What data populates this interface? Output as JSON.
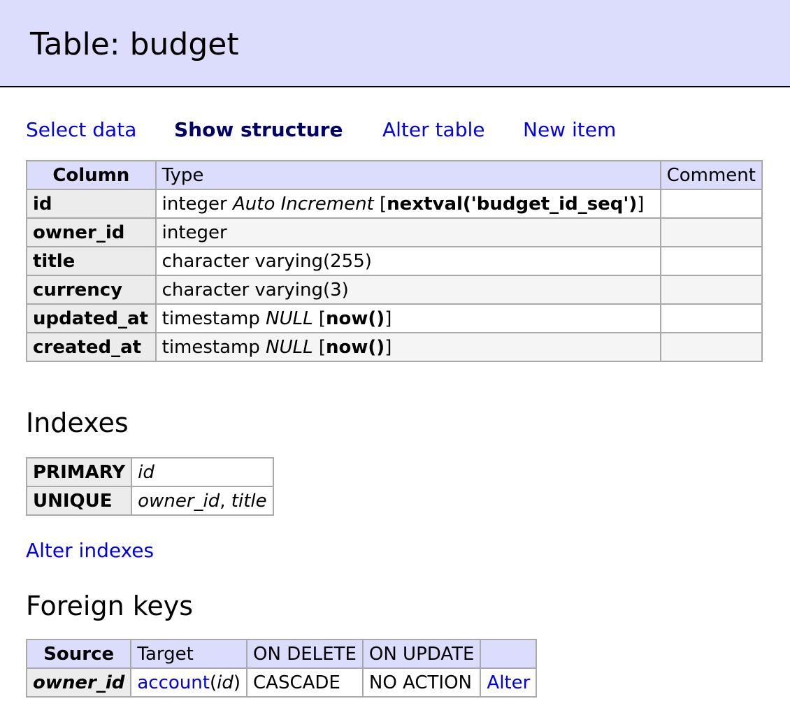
{
  "header": {
    "title": "Table: budget"
  },
  "nav": {
    "select_data": "Select data",
    "show_structure": "Show structure",
    "alter_table": "Alter table",
    "new_item": "New item"
  },
  "structure": {
    "headers": {
      "column": "Column",
      "type": "Type",
      "comment": "Comment"
    },
    "rows": [
      {
        "column": "id",
        "type_base": "integer",
        "type_extra": "Auto Increment",
        "default": "nextval('budget_id_seq')"
      },
      {
        "column": "owner_id",
        "type_base": "integer"
      },
      {
        "column": "title",
        "type_base": "character varying(255)"
      },
      {
        "column": "currency",
        "type_base": "character varying(3)"
      },
      {
        "column": "updated_at",
        "type_base": "timestamp",
        "type_extra": "NULL",
        "default": "now()"
      },
      {
        "column": "created_at",
        "type_base": "timestamp",
        "type_extra": "NULL",
        "default": "now()"
      }
    ]
  },
  "indexes": {
    "heading": "Indexes",
    "rows": [
      {
        "kind": "PRIMARY",
        "columns": [
          "id"
        ]
      },
      {
        "kind": "UNIQUE",
        "columns": [
          "owner_id",
          "title"
        ]
      }
    ],
    "alter_link": "Alter indexes"
  },
  "foreign_keys": {
    "heading": "Foreign keys",
    "headers": {
      "source": "Source",
      "target": "Target",
      "on_delete": "ON DELETE",
      "on_update": "ON UPDATE"
    },
    "rows": [
      {
        "source": "owner_id",
        "target_table": "account",
        "target_column": "id",
        "on_delete": "CASCADE",
        "on_update": "NO ACTION",
        "alter": "Alter"
      }
    ]
  }
}
